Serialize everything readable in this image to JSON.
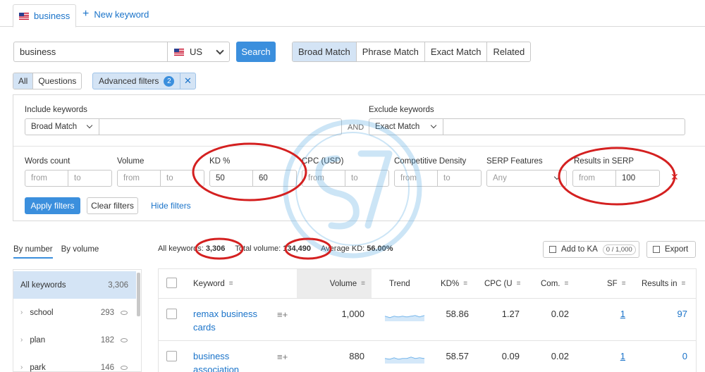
{
  "tabs": {
    "active": "business",
    "new": "New keyword"
  },
  "search": {
    "query": "business",
    "database": "US",
    "button": "Search"
  },
  "match_types": [
    "Broad Match",
    "Phrase Match",
    "Exact Match",
    "Related"
  ],
  "segments": [
    "All",
    "Questions"
  ],
  "advanced_filters": {
    "label": "Advanced filters",
    "count": "2",
    "close": "✕"
  },
  "filters": {
    "include_label": "Include keywords",
    "include_match": "Broad Match",
    "and": "AND",
    "exclude_label": "Exclude keywords",
    "exclude_match": "Exact Match",
    "words_count": {
      "label": "Words count",
      "from": "from",
      "to": "to"
    },
    "volume": {
      "label": "Volume",
      "from": "from",
      "to": "to"
    },
    "kd": {
      "label": "KD %",
      "from": "50",
      "to": "60"
    },
    "cpc": {
      "label": "CPC (USD)",
      "from": "from",
      "to": "to"
    },
    "competitive_density": {
      "label": "Competitive Density",
      "from": "from",
      "to": "to"
    },
    "serp_features": {
      "label": "SERP Features",
      "value": "Any"
    },
    "results_in_serp": {
      "label": "Results in SERP",
      "from": "from",
      "to": "100"
    },
    "apply": "Apply filters",
    "clear": "Clear filters",
    "hide": "Hide filters"
  },
  "sidebar": {
    "sort": [
      "By number",
      "By volume"
    ],
    "groups": [
      {
        "label": "All keywords",
        "count": "3,306"
      },
      {
        "label": "school",
        "count": "293"
      },
      {
        "label": "plan",
        "count": "182"
      },
      {
        "label": "park",
        "count": "146"
      }
    ]
  },
  "summary": {
    "all_label": "All keywords:",
    "all_value": "3,306",
    "volume_label": "Total volume:",
    "volume_value": "134,490",
    "kd_label": "Average KD:",
    "kd_value": "56.00%"
  },
  "actions": {
    "add_to_ka": "Add to KA",
    "ka_count": "0 / 1,000",
    "export": "Export"
  },
  "table": {
    "columns": [
      "Keyword",
      "Volume",
      "Trend",
      "KD%",
      "CPC (U",
      "Com.",
      "SF",
      "Results in"
    ],
    "rows": [
      {
        "keyword": "remax business cards",
        "volume": "1,000",
        "kd": "58.86",
        "cpc": "1.27",
        "com": "0.02",
        "sf": "1",
        "results": "97"
      },
      {
        "keyword": "business association",
        "volume": "880",
        "kd": "58.57",
        "cpc": "0.09",
        "com": "0.02",
        "sf": "1",
        "results": "0"
      }
    ]
  },
  "colors": {
    "accent": "#3b8fdd",
    "link": "#1a73c9",
    "active_bg": "#d4e4f5",
    "annotation": "#d42020"
  }
}
